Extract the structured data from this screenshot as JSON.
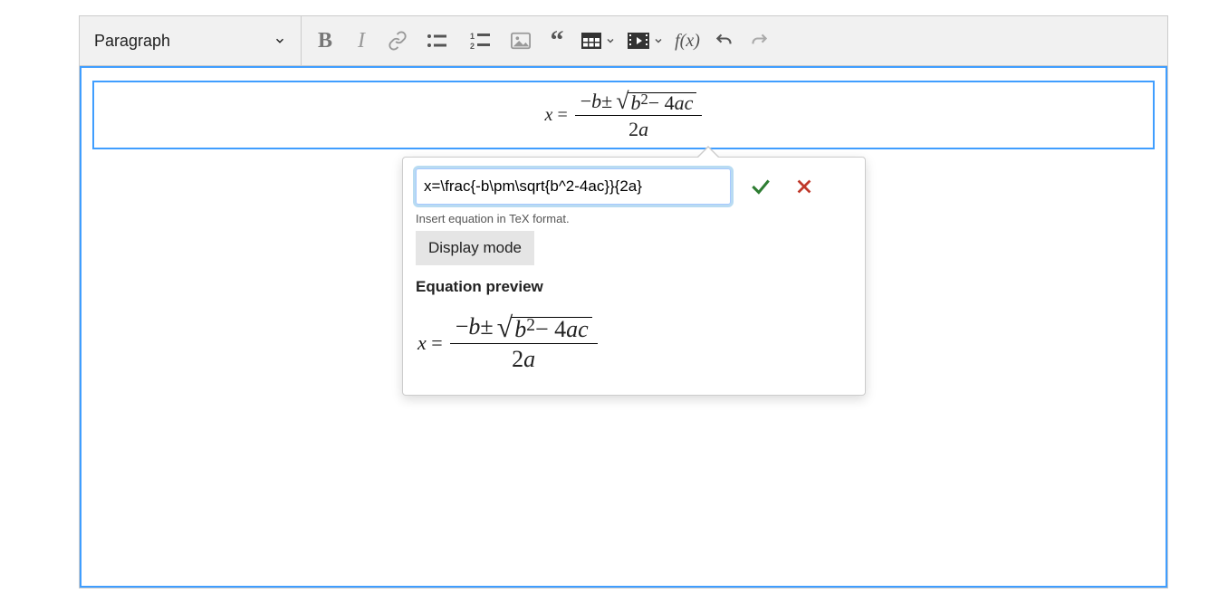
{
  "toolbar": {
    "block_format": "Paragraph",
    "equation_label": "f(x)"
  },
  "popover": {
    "tex_value": "x=\\frac{-b\\pm\\sqrt{b^2-4ac}}{2a}",
    "hint": "Insert equation in TeX format.",
    "display_mode_label": "Display mode",
    "preview_label": "Equation preview"
  },
  "equation": {
    "lhs_var": "x",
    "equals": " = ",
    "numerator": {
      "neg": "−",
      "b": "b",
      "pm": " ± ",
      "radicand": {
        "b": "b",
        "exp": "2",
        "minus": " − 4",
        "a": "a",
        "c": "c"
      }
    },
    "denominator": {
      "two": "2",
      "a": "a"
    }
  }
}
